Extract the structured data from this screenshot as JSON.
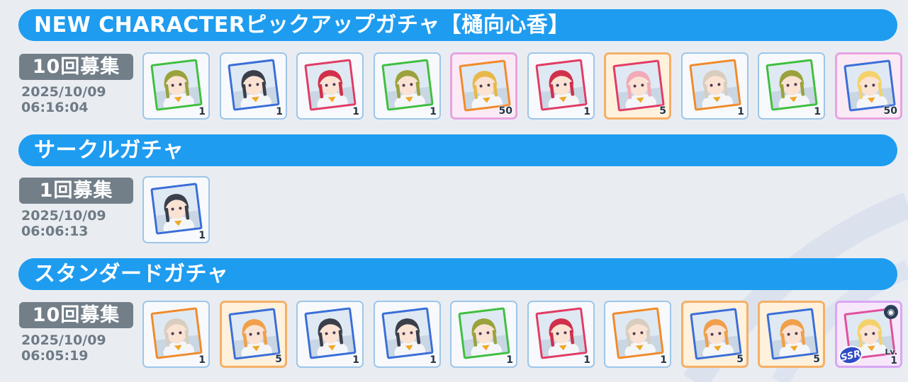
{
  "sections": [
    {
      "title": "NEW CHARACTERピックアップガチャ【樋向心香】",
      "count_label": "10回募集",
      "date": "2025/10/09",
      "time": "06:16:04",
      "cards": [
        {
          "rarity": "r",
          "frame_color": "#3fbf3f",
          "hair": "#9aa23c",
          "qty": "1"
        },
        {
          "rarity": "r",
          "frame_color": "#3a6ed8",
          "hair": "#3b3f4a",
          "qty": "1"
        },
        {
          "rarity": "r",
          "frame_color": "#e03c66",
          "hair": "#d0304a",
          "qty": "1"
        },
        {
          "rarity": "r",
          "frame_color": "#3fbf3f",
          "hair": "#9aa23c",
          "qty": "1"
        },
        {
          "rarity": "ssr",
          "frame_color": "#f08a2a",
          "hair": "#e8b84a",
          "qty": "50"
        },
        {
          "rarity": "r",
          "frame_color": "#e03c66",
          "hair": "#d0304a",
          "qty": "1"
        },
        {
          "rarity": "sr",
          "frame_color": "#e03c66",
          "hair": "#f2aab8",
          "qty": "5"
        },
        {
          "rarity": "r",
          "frame_color": "#f08a2a",
          "hair": "#d8cdbf",
          "qty": "1"
        },
        {
          "rarity": "r",
          "frame_color": "#3fbf3f",
          "hair": "#9aa23c",
          "qty": "1"
        },
        {
          "rarity": "ssr",
          "frame_color": "#3a6ed8",
          "hair": "#f4d26a",
          "qty": "50"
        }
      ]
    },
    {
      "title": "サークルガチャ",
      "count_label": "1回募集",
      "date": "2025/10/09",
      "time": "06:06:13",
      "cards": [
        {
          "rarity": "r",
          "frame_color": "#3a6ed8",
          "hair": "#3b3f4a",
          "qty": "1"
        }
      ]
    },
    {
      "title": "スタンダードガチャ",
      "count_label": "10回募集",
      "date": "2025/10/09",
      "time": "06:05:19",
      "cards": [
        {
          "rarity": "r",
          "frame_color": "#f08a2a",
          "hair": "#d8cdbf",
          "qty": "1"
        },
        {
          "rarity": "sr",
          "frame_color": "#3a6ed8",
          "hair": "#f0a04a",
          "qty": "5"
        },
        {
          "rarity": "r",
          "frame_color": "#3a6ed8",
          "hair": "#3b3f4a",
          "qty": "1"
        },
        {
          "rarity": "r",
          "frame_color": "#3a6ed8",
          "hair": "#3b3f4a",
          "qty": "1"
        },
        {
          "rarity": "r",
          "frame_color": "#3fbf3f",
          "hair": "#9aa23c",
          "qty": "1"
        },
        {
          "rarity": "r",
          "frame_color": "#e03c66",
          "hair": "#d0304a",
          "qty": "1"
        },
        {
          "rarity": "r",
          "frame_color": "#f08a2a",
          "hair": "#d8cdbf",
          "qty": "1"
        },
        {
          "rarity": "sr",
          "frame_color": "#3a6ed8",
          "hair": "#f0a04a",
          "qty": "5"
        },
        {
          "rarity": "sr",
          "frame_color": "#3a6ed8",
          "hair": "#f0a04a",
          "qty": "5"
        },
        {
          "rarity": "big",
          "frame_color": "#e0509c",
          "hair": "#f4d26a",
          "qty": "1",
          "badge": "SSR",
          "lv_label": "Lv."
        }
      ]
    }
  ],
  "colors": {
    "banner": "#1e9cf0",
    "count_badge": "#727e88",
    "background": "#e9edf2"
  }
}
